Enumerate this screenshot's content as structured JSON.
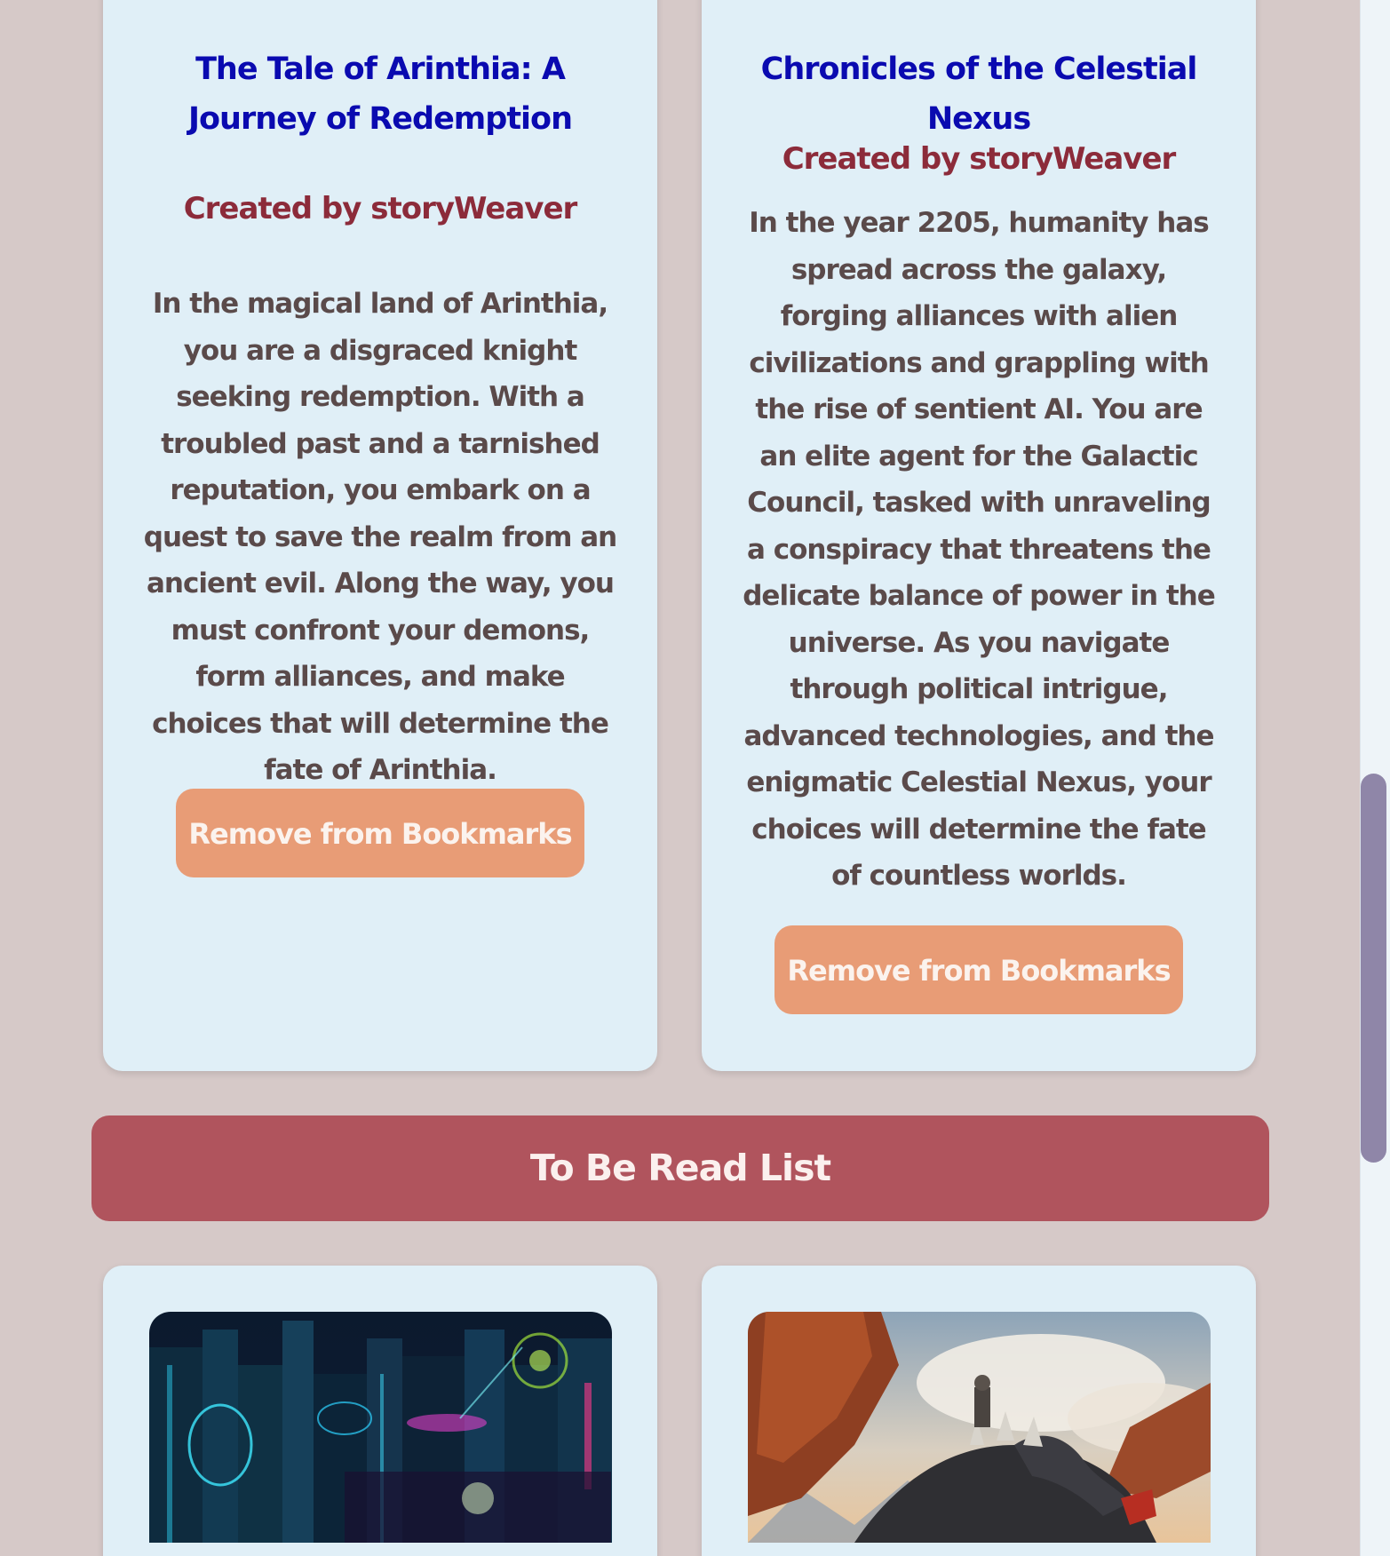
{
  "bookmarks": {
    "cards": [
      {
        "title": "The Tale of Arinthia: A Journey of Redemption",
        "author": "Created by storyWeaver",
        "description": "In the magical land of Arinthia, you are a disgraced knight seeking redemption. With a troubled past and a tarnished reputation, you embark on a quest to save the realm from an ancient evil. Along the way, you must confront your demons, form alliances, and make choices that will determine the fate of Arinthia.",
        "button_label": "Remove from Bookmarks"
      },
      {
        "title": "Chronicles of the Celestial Nexus",
        "author": "Created by storyWeaver",
        "description": "In the year 2205, humanity has spread across the galaxy, forging alliances with alien civilizations and grappling with the rise of sentient AI. You are an elite agent for the Galactic Council, tasked with unraveling a conspiracy that threatens the delicate balance of power in the universe. As you navigate through political intrigue, advanced technologies, and the enigmatic Celestial Nexus, your choices will determine the fate of countless worlds.",
        "button_label": "Remove from Bookmarks"
      }
    ]
  },
  "to_be_read": {
    "heading": "To Be Read List",
    "cards": [
      {
        "image": "cyberpunk-city-illustration"
      },
      {
        "image": "dragon-rider-illustration"
      }
    ]
  },
  "colors": {
    "page_bg": "#d6c9c8",
    "card_bg": "#e0eff7",
    "title": "#0a0ab0",
    "author": "#8c2b3a",
    "body_text": "#5a4a4a",
    "button": "#e89c76",
    "banner": "#b0545d",
    "scrollbar_thumb": "#8f86a8"
  }
}
